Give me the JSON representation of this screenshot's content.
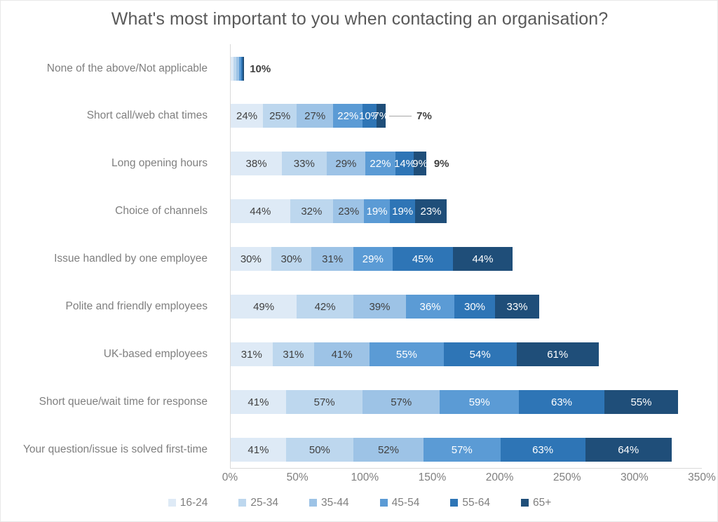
{
  "chart_data": {
    "type": "bar",
    "orientation": "horizontal",
    "stacked": true,
    "title": "What's most important to you when contacting an organisation?",
    "xlabel": "",
    "ylabel": "",
    "xlim": [
      0,
      350
    ],
    "xticks": [
      "0%",
      "50%",
      "100%",
      "150%",
      "200%",
      "250%",
      "300%",
      "350%"
    ],
    "xtick_values": [
      0,
      50,
      100,
      150,
      200,
      250,
      300,
      350
    ],
    "grid": false,
    "legend_position": "bottom",
    "value_suffix": "%",
    "categories": [
      "None of the above/Not applicable",
      "Short call/web chat times",
      "Long opening hours",
      "Choice of channels",
      "Issue handled by one employee",
      "Polite and friendly employees",
      "UK-based employees",
      "Short queue/wait time for response",
      "Your question/issue is solved first-time"
    ],
    "series": [
      {
        "name": "16-24",
        "color": "#DEEAF6",
        "label_color": "#404040",
        "values": [
          2,
          24,
          38,
          44,
          30,
          49,
          31,
          41,
          41
        ]
      },
      {
        "name": "25-34",
        "color": "#BDD7EE",
        "label_color": "#404040",
        "values": [
          2,
          25,
          33,
          32,
          30,
          42,
          31,
          57,
          50
        ]
      },
      {
        "name": "35-44",
        "color": "#9DC3E6",
        "label_color": "#404040",
        "values": [
          2,
          27,
          29,
          23,
          31,
          39,
          41,
          57,
          52
        ]
      },
      {
        "name": "45-54",
        "color": "#5B9BD5",
        "label_color": "#FFFFFF",
        "values": [
          2,
          22,
          22,
          19,
          29,
          36,
          55,
          59,
          57
        ]
      },
      {
        "name": "55-64",
        "color": "#2E75B6",
        "label_color": "#FFFFFF",
        "values": [
          1,
          10,
          14,
          19,
          45,
          30,
          54,
          63,
          63
        ]
      },
      {
        "name": "65+",
        "color": "#1F4E79",
        "label_color": "#FFFFFF",
        "values": [
          1,
          7,
          9,
          23,
          44,
          33,
          61,
          55,
          64
        ]
      }
    ],
    "displayed_labels": [
      [
        "",
        "",
        "",
        "",
        "",
        ""
      ],
      [
        "24%",
        "25%",
        "27%",
        "22%",
        "10%",
        "7%"
      ],
      [
        "38%",
        "33%",
        "29%",
        "22%",
        "14%",
        "9%"
      ],
      [
        "44%",
        "32%",
        "23%",
        "19%",
        "19%",
        "23%"
      ],
      [
        "30%",
        "30%",
        "31%",
        "29%",
        "45%",
        "44%"
      ],
      [
        "49%",
        "42%",
        "39%",
        "36%",
        "30%",
        "33%"
      ],
      [
        "31%",
        "31%",
        "41%",
        "55%",
        "54%",
        "61%"
      ],
      [
        "41%",
        "57%",
        "57%",
        "59%",
        "63%",
        "55%"
      ],
      [
        "41%",
        "50%",
        "52%",
        "57%",
        "63%",
        "64%"
      ]
    ],
    "outside_annotations": [
      {
        "row": 0,
        "text": "10%",
        "note": "total label for tiny bar"
      },
      {
        "row": 1,
        "text": "7%",
        "note": "65+ value with leader line"
      },
      {
        "row": 2,
        "text": "9%",
        "note": "65+ value placed outside"
      }
    ],
    "row_totals": [
      "10%",
      "115%",
      "145%",
      "160%",
      "209%",
      "229%",
      "273%",
      "332%",
      "327%"
    ]
  },
  "legend": {
    "items": [
      {
        "label": "16-24",
        "color": "#DEEAF6"
      },
      {
        "label": "25-34",
        "color": "#BDD7EE"
      },
      {
        "label": "35-44",
        "color": "#9DC3E6"
      },
      {
        "label": "45-54",
        "color": "#5B9BD5"
      },
      {
        "label": "55-64",
        "color": "#2E75B6"
      },
      {
        "label": "65+",
        "color": "#1F4E79"
      }
    ]
  },
  "theme": {
    "background": "#FFFFFF",
    "title_color": "#595959",
    "tick_color": "#7F7F7F",
    "axis_color": "#D9D9D9",
    "annotation_color": "#404040"
  }
}
